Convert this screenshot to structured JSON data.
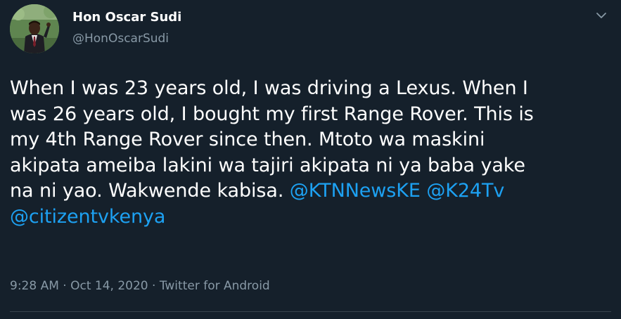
{
  "tweet": {
    "author": {
      "name": "Hon Oscar Sudi",
      "handle": "@HonOscarSudi"
    },
    "text_lines": [
      "When I was 23 years old, I was driving a Lexus. When I",
      "was 26 years old, I bought my first Range Rover. This is",
      "my 4th Range Rover since then. Mtoto wa maskini",
      "akipata ameiba lakini wa tajiri akipata ni ya baba yake",
      "na ni yao. Wakwende kabisa. "
    ],
    "mentions": [
      "@KTNNewsKE",
      "@K24Tv",
      "@citizentvkenya"
    ],
    "time": "9:28 AM",
    "date": "Oct 14, 2020",
    "source": "Twitter for Android",
    "separator": "·"
  },
  "icons": {
    "caret": "chevron-down-icon",
    "avatar": "avatar"
  },
  "colors": {
    "background": "#15202b",
    "text": "#ffffff",
    "secondary": "#8899a6",
    "link": "#1da1f2",
    "divider": "#38444d"
  }
}
